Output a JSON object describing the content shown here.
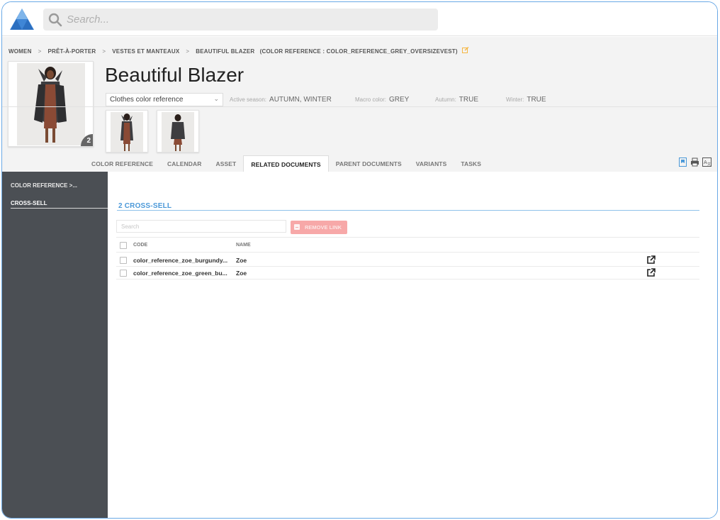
{
  "topbar": {
    "logo": "akeneo-triangle-logo",
    "search_placeholder": "Search...",
    "search_icon": "magnifier-icon"
  },
  "breadcrumb": [
    "WOMEN",
    "PRÊT-À-PORTER",
    "VESTES ET MANTEAUX",
    "BEAUTIFUL BLAZER",
    "(COLOR REFERENCE : COLOR_REFERENCE_GREY_OVERSIZEVEST)"
  ],
  "breadcrumb_separator": ">",
  "product": {
    "title": "Beautiful Blazer",
    "image_count": "2",
    "type_select": "Clothes color reference",
    "attributes": [
      {
        "label": "Active season:",
        "value": "AUTUMN, WINTER"
      },
      {
        "label": "Macro color:",
        "value": "GREY"
      },
      {
        "label": "Autumn:",
        "value": "TRUE"
      },
      {
        "label": "Winter:",
        "value": "TRUE"
      }
    ]
  },
  "tabs": [
    "COLOR REFERENCE",
    "CALENDAR",
    "ASSET",
    "RELATED DOCUMENTS",
    "PARENT DOCUMENTS",
    "VARIANTS",
    "TASKS"
  ],
  "active_tab": "RELATED DOCUMENTS",
  "tools": [
    "bookmark-icon",
    "print-icon",
    "translate-icon"
  ],
  "sidebar": {
    "items": [
      {
        "label": "COLOR REFERENCE >..."
      },
      {
        "label": "CROSS-SELL"
      }
    ],
    "active": "CROSS-SELL"
  },
  "section": {
    "title": "2 CROSS-SELL",
    "search_placeholder": "Search",
    "remove_button": "REMOVE LINK"
  },
  "table": {
    "columns": [
      "CODE",
      "NAME"
    ],
    "rows": [
      {
        "code": "color_reference_zoe_burgundy...",
        "name": "Zoe"
      },
      {
        "code": "color_reference_zoe_green_bu...",
        "name": "Zoe"
      }
    ]
  },
  "colors": {
    "accent": "#4a98d8",
    "sidebar": "#4b4f54",
    "danger_disabled": "#f7a8a8",
    "edit_icon": "#f5b642"
  }
}
